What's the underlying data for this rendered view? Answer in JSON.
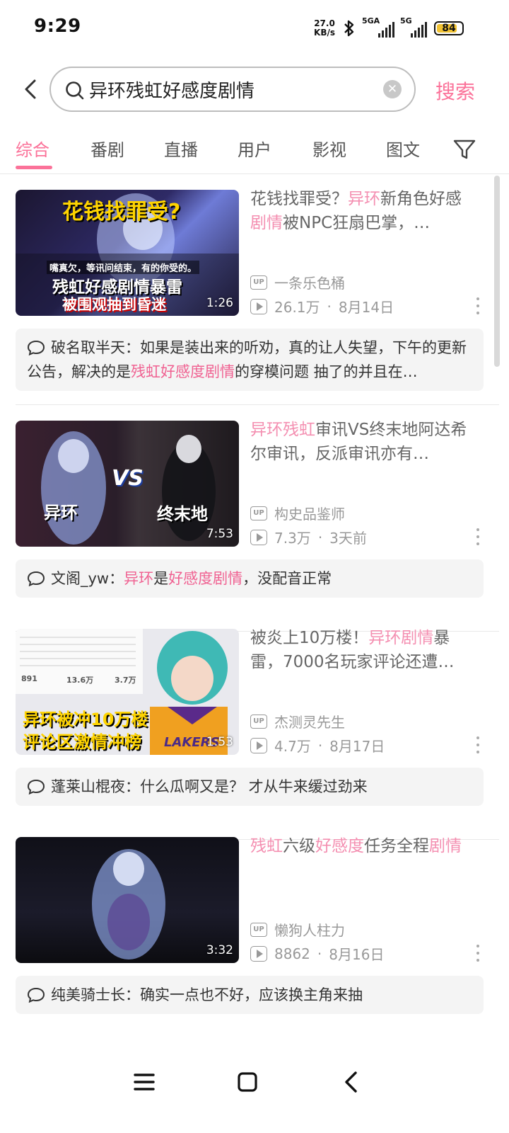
{
  "status_bar": {
    "time": "9:29",
    "net_speed_value": "27.0",
    "net_speed_unit": "KB/s",
    "signal1_label": "5GA",
    "signal2_label": "5G",
    "battery": "84"
  },
  "search": {
    "query": "异环残虹好感度剧情",
    "button_label": "搜索"
  },
  "tabs": [
    "综合",
    "番剧",
    "直播",
    "用户",
    "影视",
    "图文"
  ],
  "active_tab": 0,
  "colors": {
    "accent": "#fb7299",
    "highlight": "#f48fb1"
  },
  "results": [
    {
      "title_parts": [
        {
          "text": "花钱找罪受？",
          "hl": false
        },
        {
          "text": "异环",
          "hl": true
        },
        {
          "text": "新角色好感",
          "hl": false
        },
        {
          "text": "剧情",
          "hl": true
        },
        {
          "text": "被NPC狂扇巴掌，…",
          "hl": false
        }
      ],
      "duration": "1:26",
      "up_name": "一条乐色桶",
      "views": "26.1万",
      "date": "8月14日",
      "thumb_lines": [
        "花钱找罪受?",
        "嘴真欠，等讯问结束，有的你受的。",
        "残虹好感剧情暴雷",
        "被围观抽到昏迷"
      ],
      "comment_parts": [
        {
          "text": "破名取半天：如果是装出来的听劝，真的让人失望，下午的更新公告，解决的是",
          "hl": false
        },
        {
          "text": "残虹好感度剧情",
          "hl": true
        },
        {
          "text": "的穿模问题 抽了的并且在…",
          "hl": false
        }
      ]
    },
    {
      "title_parts": [
        {
          "text": "异环残虹",
          "hl": true
        },
        {
          "text": "审讯VS终末地阿达希尔审讯，反派审讯亦有…",
          "hl": false
        }
      ],
      "duration": "7:53",
      "up_name": "构史品鉴师",
      "views": "7.3万",
      "date": "3天前",
      "thumb_lines": [
        "异环",
        "VS",
        "终末地"
      ],
      "comment_parts": [
        {
          "text": "文阁_yw：",
          "hl": false
        },
        {
          "text": "异环",
          "hl": true
        },
        {
          "text": "是",
          "hl": false
        },
        {
          "text": "好感度剧情",
          "hl": true
        },
        {
          "text": "，没配音正常",
          "hl": false
        }
      ]
    },
    {
      "title_parts": [
        {
          "text": "被炎上10万楼！",
          "hl": false
        },
        {
          "text": "异环剧情",
          "hl": true
        },
        {
          "text": "暴雷，7000名玩家评论还遭…",
          "hl": false
        }
      ],
      "duration": "1:53",
      "up_name": "杰测灵先生",
      "views": "4.7万",
      "date": "8月17日",
      "thumb_lines": [
        "异环被冲10万楼",
        "评论区激情冲榜",
        "LAKERS",
        "891",
        "13.6万",
        "3.7万"
      ],
      "comment_parts": [
        {
          "text": "蓬莱山棍夜：什么瓜啊又是？ 才从牛来缓过劲来",
          "hl": false
        }
      ]
    },
    {
      "title_parts": [
        {
          "text": "残虹",
          "hl": true
        },
        {
          "text": "六级",
          "hl": false
        },
        {
          "text": "好感度",
          "hl": true
        },
        {
          "text": "任务全程",
          "hl": false
        },
        {
          "text": "剧情",
          "hl": true
        }
      ],
      "duration": "3:32",
      "up_name": "懒狗人柱力",
      "views": "8862",
      "date": "8月16日",
      "thumb_lines": [],
      "comment_parts": [
        {
          "text": "纯美骑士长：确实一点也不好，应该换主角来抽",
          "hl": false
        }
      ]
    }
  ]
}
